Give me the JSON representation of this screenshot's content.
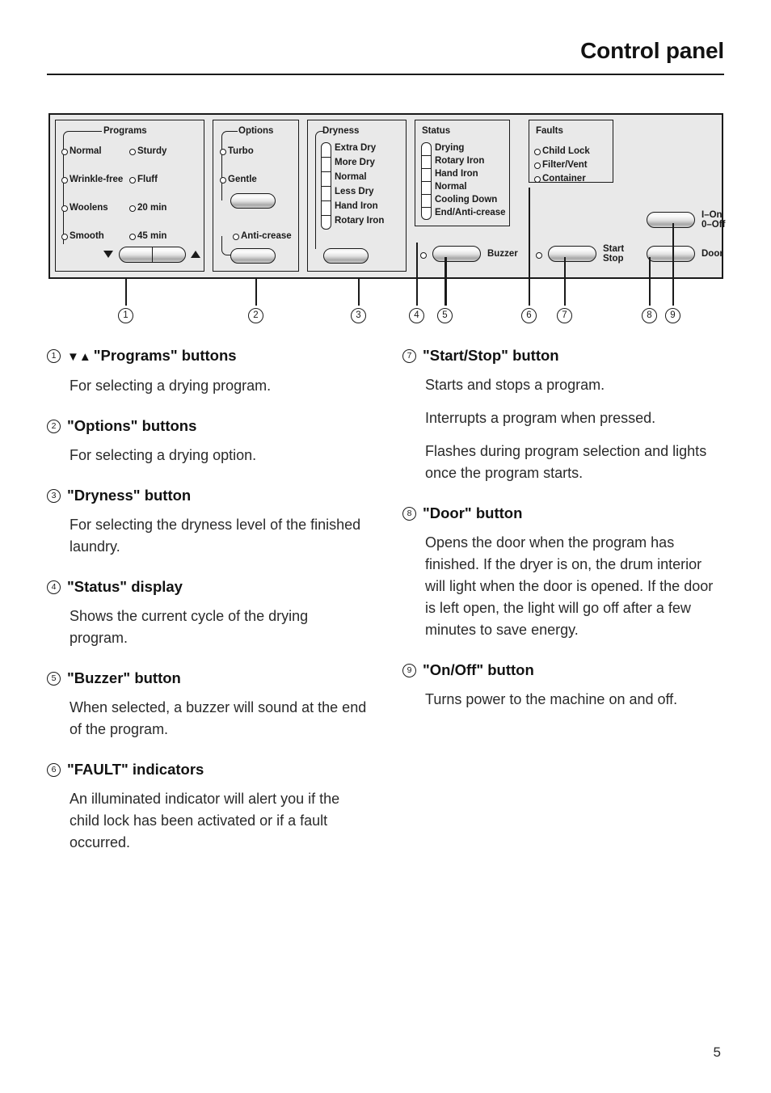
{
  "header": {
    "title": "Control panel"
  },
  "footer": {
    "page_number": "5"
  },
  "colors": {
    "panel_background": "#e9e9e9",
    "outline": "#1a1a1a",
    "page_background": "#ffffff"
  },
  "panel": {
    "groups": {
      "programs": {
        "title": "Programs",
        "options_left": [
          "Normal",
          "Wrinkle-free",
          "Woolens",
          "Smooth"
        ],
        "options_right": [
          "Sturdy",
          "Fluff",
          "20 min",
          "45 min"
        ],
        "rocker_down": "▼",
        "rocker_up": "▲"
      },
      "options": {
        "title": "Options",
        "options": [
          "Turbo",
          "Gentle"
        ],
        "extra_option": "Anti-crease"
      },
      "dryness": {
        "title": "Dryness",
        "levels": [
          "Extra Dry",
          "More Dry",
          "Normal",
          "Less Dry",
          "Hand Iron",
          "Rotary Iron"
        ]
      },
      "status": {
        "title": "Status",
        "levels": [
          "Drying",
          "Rotary Iron",
          "Hand Iron",
          "Normal",
          "Cooling Down",
          "End/Anti-crease"
        ]
      },
      "faults": {
        "title": "Faults",
        "indicators": [
          "Child Lock",
          "Filter/Vent",
          "Container"
        ]
      }
    },
    "buttons": {
      "buzzer": "Buzzer",
      "start_stop_line1": "Start",
      "start_stop_line2": "Stop",
      "onoff_line1": "I–On",
      "onoff_line2": "0–Off",
      "door": "Door"
    },
    "callouts": [
      "1",
      "2",
      "3",
      "4",
      "5",
      "6",
      "7",
      "8",
      "9"
    ]
  },
  "entries": {
    "left": [
      {
        "num": "1",
        "arrows": "▼▲",
        "title": "\"Programs\" buttons",
        "paragraphs": [
          "For selecting a drying program."
        ]
      },
      {
        "num": "2",
        "arrows": "",
        "title": "\"Options\" buttons",
        "paragraphs": [
          "For selecting a drying option."
        ]
      },
      {
        "num": "3",
        "arrows": "",
        "title": "\"Dryness\" button",
        "paragraphs": [
          "For selecting the dryness level of the finished laundry."
        ]
      },
      {
        "num": "4",
        "arrows": "",
        "title": "\"Status\" display",
        "paragraphs": [
          "Shows the current cycle of the drying program."
        ]
      },
      {
        "num": "5",
        "arrows": "",
        "title": "\"Buzzer\" button",
        "paragraphs": [
          "When selected, a buzzer will sound at the end of the program."
        ]
      },
      {
        "num": "6",
        "arrows": "",
        "title": "\"FAULT\" indicators",
        "paragraphs": [
          "An illuminated indicator will alert you if the child lock has been activated or if a fault occurred."
        ]
      }
    ],
    "right": [
      {
        "num": "7",
        "arrows": "",
        "title": "\"Start/Stop\" button",
        "paragraphs": [
          "Starts and stops a program.",
          "Interrupts a program when pressed.",
          "Flashes during program selection and lights once the program starts."
        ]
      },
      {
        "num": "8",
        "arrows": "",
        "title": "\"Door\" button",
        "paragraphs": [
          "Opens the door when the program has finished. If the dryer is on, the drum interior will light when the door is opened. If the door is left open, the light will go off after a few minutes to save energy."
        ]
      },
      {
        "num": "9",
        "arrows": "",
        "title": "\"On/Off\" button",
        "paragraphs": [
          "Turns power to the machine on and off."
        ]
      }
    ]
  }
}
